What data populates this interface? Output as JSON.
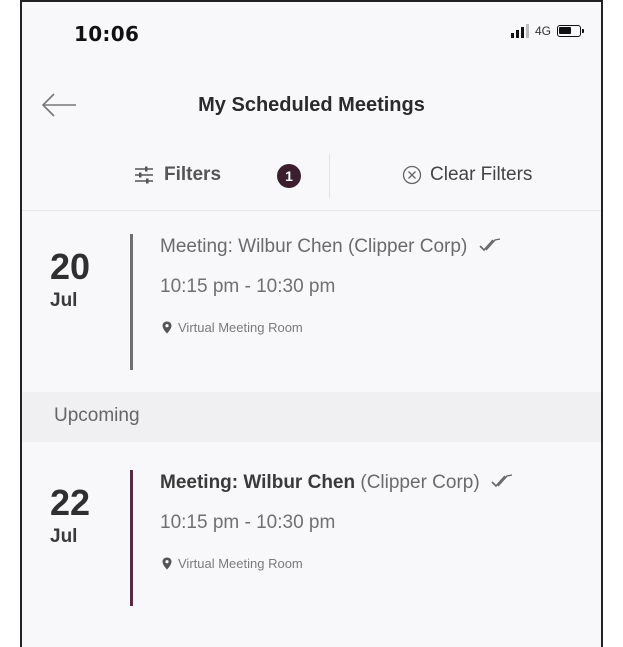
{
  "status_bar": {
    "time": "10:06",
    "network": "4G"
  },
  "header": {
    "title": "My Scheduled Meetings"
  },
  "filter_bar": {
    "filters_label": "Filters",
    "filter_count": "1",
    "clear_label": "Clear Filters"
  },
  "meetings": [
    {
      "day": "20",
      "month": "Jul",
      "title": "Meeting: Wilbur Chen (Clipper Corp)",
      "time": "10:15 pm - 10:30 pm",
      "location": "Virtual Meeting Room"
    },
    {
      "day": "22",
      "month": "Jul",
      "title_bold": "Meeting: Wilbur Chen",
      "title_rest": " (Clipper Corp)",
      "time": "10:15 pm - 10:30 pm",
      "location": "Virtual Meeting Room"
    }
  ],
  "sections": {
    "upcoming": "Upcoming"
  },
  "colors": {
    "accent": "#3b1f2e",
    "past_bar": "#6f6f6f",
    "upcoming_bar": "#5a2a40"
  }
}
